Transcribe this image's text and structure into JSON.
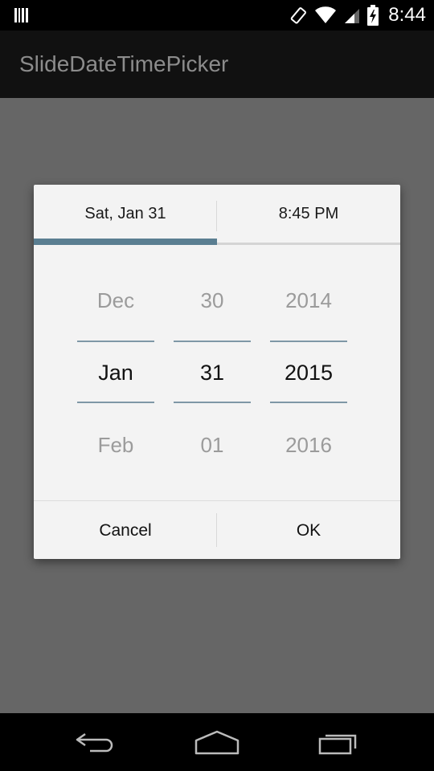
{
  "status_bar": {
    "time": "8:44",
    "icons": [
      "barcode-icon",
      "rotate-icon",
      "wifi-icon",
      "signal-icon",
      "battery-charging-icon"
    ]
  },
  "app": {
    "title": "SlideDateTimePicker"
  },
  "dialog": {
    "tabs": {
      "date_label": "Sat, Jan 31",
      "time_label": "8:45 PM",
      "selected": "date"
    },
    "picker": {
      "month": {
        "prev": "Dec",
        "current": "Jan",
        "next": "Feb"
      },
      "day": {
        "prev": "30",
        "current": "31",
        "next": "01"
      },
      "year": {
        "prev": "2014",
        "current": "2015",
        "next": "2016"
      }
    },
    "buttons": {
      "cancel": "Cancel",
      "ok": "OK"
    }
  },
  "nav_bar": {
    "icons": [
      "back-icon",
      "home-icon",
      "recent-apps-icon"
    ]
  },
  "colors": {
    "accent": "#5a7e91",
    "background": "#666666",
    "dialog": "#f3f3f3"
  }
}
